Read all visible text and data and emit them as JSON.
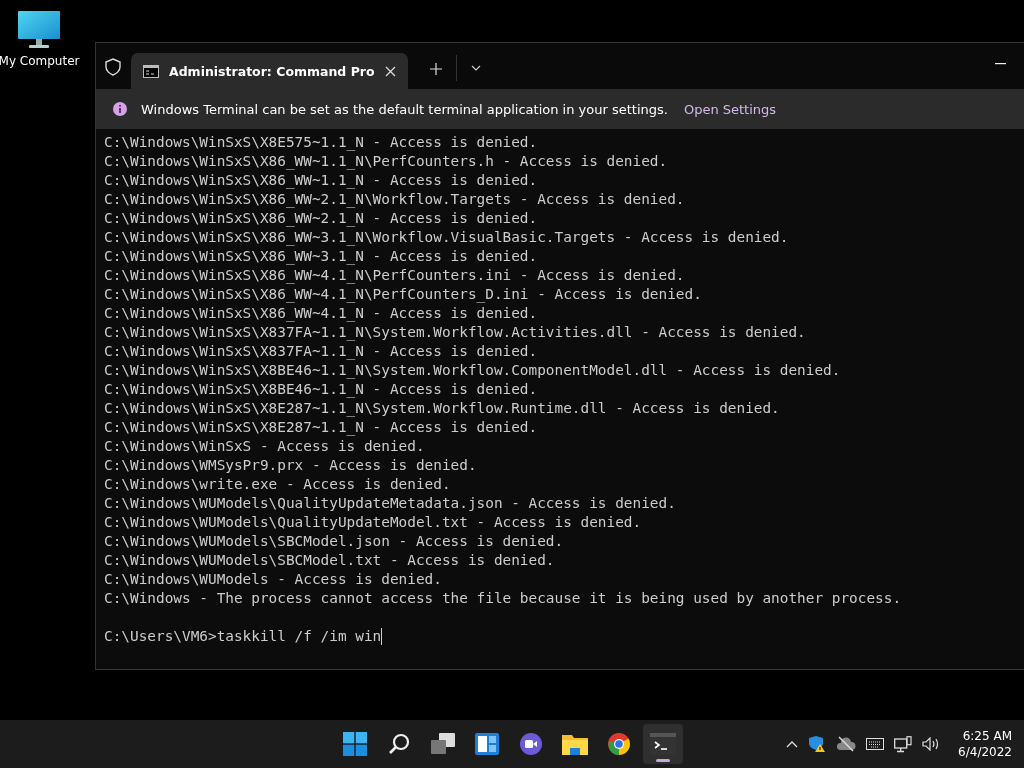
{
  "desktop": {
    "icons": [
      {
        "label": "My Computer"
      }
    ]
  },
  "window": {
    "tabs": [
      {
        "title": "Administrator: Command Pro",
        "selected": true
      }
    ],
    "infobar": {
      "message": "Windows Terminal can be set as the default terminal application in your settings.",
      "link": "Open Settings"
    },
    "terminal": {
      "lines": [
        "C:\\Windows\\WinSxS\\X8E575~1.1_N - Access is denied.",
        "C:\\Windows\\WinSxS\\X86_WW~1.1_N\\PerfCounters.h - Access is denied.",
        "C:\\Windows\\WinSxS\\X86_WW~1.1_N - Access is denied.",
        "C:\\Windows\\WinSxS\\X86_WW~2.1_N\\Workflow.Targets - Access is denied.",
        "C:\\Windows\\WinSxS\\X86_WW~2.1_N - Access is denied.",
        "C:\\Windows\\WinSxS\\X86_WW~3.1_N\\Workflow.VisualBasic.Targets - Access is denied.",
        "C:\\Windows\\WinSxS\\X86_WW~3.1_N - Access is denied.",
        "C:\\Windows\\WinSxS\\X86_WW~4.1_N\\PerfCounters.ini - Access is denied.",
        "C:\\Windows\\WinSxS\\X86_WW~4.1_N\\PerfCounters_D.ini - Access is denied.",
        "C:\\Windows\\WinSxS\\X86_WW~4.1_N - Access is denied.",
        "C:\\Windows\\WinSxS\\X837FA~1.1_N\\System.Workflow.Activities.dll - Access is denied.",
        "C:\\Windows\\WinSxS\\X837FA~1.1_N - Access is denied.",
        "C:\\Windows\\WinSxS\\X8BE46~1.1_N\\System.Workflow.ComponentModel.dll - Access is denied.",
        "C:\\Windows\\WinSxS\\X8BE46~1.1_N - Access is denied.",
        "C:\\Windows\\WinSxS\\X8E287~1.1_N\\System.Workflow.Runtime.dll - Access is denied.",
        "C:\\Windows\\WinSxS\\X8E287~1.1_N - Access is denied.",
        "C:\\Windows\\WinSxS - Access is denied.",
        "C:\\Windows\\WMSysPr9.prx - Access is denied.",
        "C:\\Windows\\write.exe - Access is denied.",
        "C:\\Windows\\WUModels\\QualityUpdateMetadata.json - Access is denied.",
        "C:\\Windows\\WUModels\\QualityUpdateModel.txt - Access is denied.",
        "C:\\Windows\\WUModels\\SBCModel.json - Access is denied.",
        "C:\\Windows\\WUModels\\SBCModel.txt - Access is denied.",
        "C:\\Windows\\WUModels - Access is denied.",
        "C:\\Windows - The process cannot access the file because it is being used by another process."
      ],
      "prompt": "C:\\Users\\VM6>taskkill /f /im win"
    }
  },
  "taskbar": {
    "apps": [
      {
        "kind": "start",
        "selected": false
      },
      {
        "kind": "search",
        "selected": false
      },
      {
        "kind": "taskview",
        "selected": false
      },
      {
        "kind": "widgets",
        "selected": false
      },
      {
        "kind": "chat",
        "selected": false
      },
      {
        "kind": "explorer",
        "selected": false
      },
      {
        "kind": "chrome",
        "selected": false
      },
      {
        "kind": "terminal",
        "selected": true
      }
    ],
    "clock": {
      "time": "6:25 AM",
      "date": "6/4/2022"
    }
  }
}
